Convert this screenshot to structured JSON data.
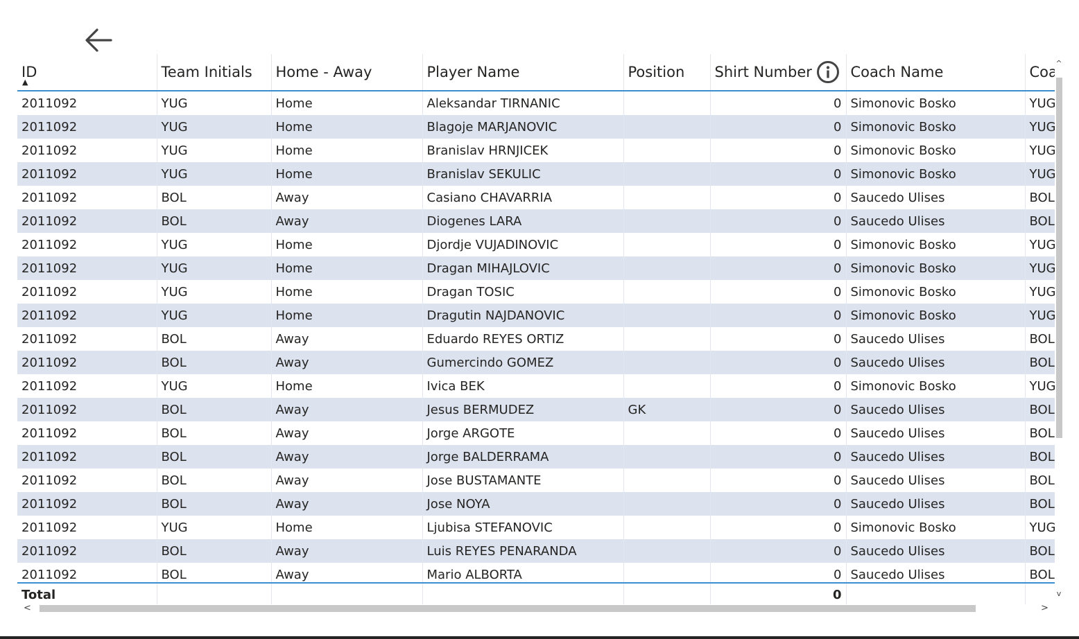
{
  "table": {
    "columns": [
      "ID",
      "Team Initials",
      "Home - Away",
      "Player Name",
      "Position",
      "Shirt Number",
      "Coach Name",
      "Coa"
    ],
    "sort": {
      "column": "ID",
      "direction": "ascending"
    },
    "rows": [
      [
        "2011092",
        "YUG",
        "Home",
        "Aleksandar TIRNANIC",
        "",
        "0",
        "Simonovic Bosko",
        "YUG"
      ],
      [
        "2011092",
        "YUG",
        "Home",
        "Blagoje MARJANOVIC",
        "",
        "0",
        "Simonovic Bosko",
        "YUG"
      ],
      [
        "2011092",
        "YUG",
        "Home",
        "Branislav HRNJICEK",
        "",
        "0",
        "Simonovic Bosko",
        "YUG"
      ],
      [
        "2011092",
        "YUG",
        "Home",
        "Branislav SEKULIC",
        "",
        "0",
        "Simonovic Bosko",
        "YUG"
      ],
      [
        "2011092",
        "BOL",
        "Away",
        "Casiano CHAVARRIA",
        "",
        "0",
        "Saucedo Ulises",
        "BOL"
      ],
      [
        "2011092",
        "BOL",
        "Away",
        "Diogenes LARA",
        "",
        "0",
        "Saucedo Ulises",
        "BOL"
      ],
      [
        "2011092",
        "YUG",
        "Home",
        "Djordje VUJADINOVIC",
        "",
        "0",
        "Simonovic Bosko",
        "YUG"
      ],
      [
        "2011092",
        "YUG",
        "Home",
        "Dragan MIHAJLOVIC",
        "",
        "0",
        "Simonovic Bosko",
        "YUG"
      ],
      [
        "2011092",
        "YUG",
        "Home",
        "Dragan TOSIC",
        "",
        "0",
        "Simonovic Bosko",
        "YUG"
      ],
      [
        "2011092",
        "YUG",
        "Home",
        "Dragutin NAJDANOVIC",
        "",
        "0",
        "Simonovic Bosko",
        "YUG"
      ],
      [
        "2011092",
        "BOL",
        "Away",
        "Eduardo REYES ORTIZ",
        "",
        "0",
        "Saucedo Ulises",
        "BOL"
      ],
      [
        "2011092",
        "BOL",
        "Away",
        "Gumercindo GOMEZ",
        "",
        "0",
        "Saucedo Ulises",
        "BOL"
      ],
      [
        "2011092",
        "YUG",
        "Home",
        "Ivica BEK",
        "",
        "0",
        "Simonovic Bosko",
        "YUG"
      ],
      [
        "2011092",
        "BOL",
        "Away",
        "Jesus BERMUDEZ",
        "GK",
        "0",
        "Saucedo Ulises",
        "BOL"
      ],
      [
        "2011092",
        "BOL",
        "Away",
        "Jorge ARGOTE",
        "",
        "0",
        "Saucedo Ulises",
        "BOL"
      ],
      [
        "2011092",
        "BOL",
        "Away",
        "Jorge BALDERRAMA",
        "",
        "0",
        "Saucedo Ulises",
        "BOL"
      ],
      [
        "2011092",
        "BOL",
        "Away",
        "Jose BUSTAMANTE",
        "",
        "0",
        "Saucedo Ulises",
        "BOL"
      ],
      [
        "2011092",
        "BOL",
        "Away",
        "Jose NOYA",
        "",
        "0",
        "Saucedo Ulises",
        "BOL"
      ],
      [
        "2011092",
        "YUG",
        "Home",
        "Ljubisa STEFANOVIC",
        "",
        "0",
        "Simonovic Bosko",
        "YUG"
      ],
      [
        "2011092",
        "BOL",
        "Away",
        "Luis REYES PENARANDA",
        "",
        "0",
        "Saucedo Ulises",
        "BOL"
      ],
      [
        "2011092",
        "BOL",
        "Away",
        "Mario ALBORTA",
        "",
        "0",
        "Saucedo Ulises",
        "BOL"
      ]
    ],
    "total": {
      "label": "Total",
      "shirt_number": "0"
    }
  },
  "icons": {
    "back": "left-arrow-icon",
    "sort": "sort-ascending-icon",
    "info": "info-icon"
  },
  "colors": {
    "header_border": "#3b8ed0",
    "band_row": "#dce3ef",
    "text": "#252423",
    "scroll_thumb": "#c8c8c8"
  },
  "scroll": {
    "vertical_position": 0.0,
    "horizontal_position": 0.0,
    "scroll_up_glyph": "^",
    "scroll_down_glyph": "v",
    "scroll_left_glyph": "<",
    "scroll_right_glyph": ">"
  }
}
